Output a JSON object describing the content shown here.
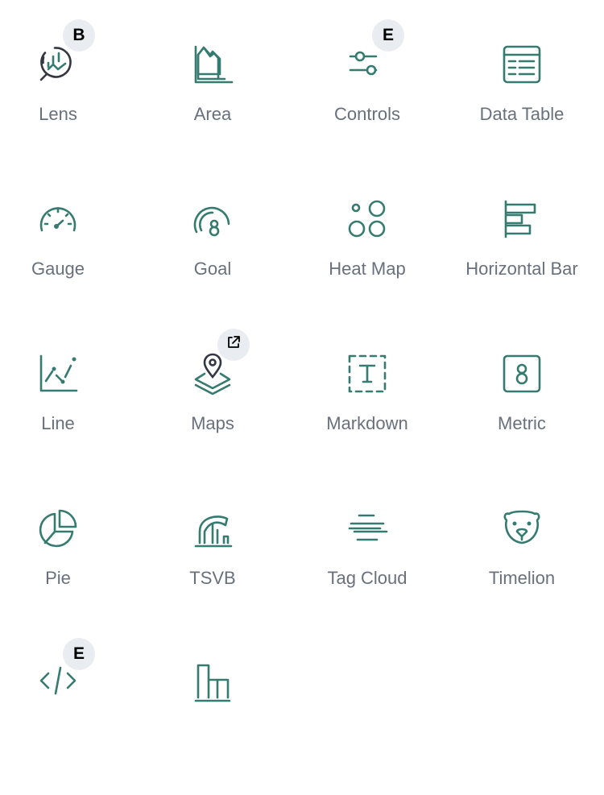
{
  "accent_color": "#357b70",
  "label_color": "#69707d",
  "items": [
    {
      "label": "Lens",
      "icon": "lens-icon",
      "badge": "B"
    },
    {
      "label": "Area",
      "icon": "area-chart-icon"
    },
    {
      "label": "Controls",
      "icon": "controls-icon",
      "badge": "E"
    },
    {
      "label": "Data Table",
      "icon": "data-table-icon"
    },
    {
      "label": "Gauge",
      "icon": "gauge-icon"
    },
    {
      "label": "Goal",
      "icon": "goal-icon"
    },
    {
      "label": "Heat Map",
      "icon": "heat-map-icon"
    },
    {
      "label": "Horizontal Bar",
      "icon": "horizontal-bar-icon"
    },
    {
      "label": "Line",
      "icon": "line-chart-icon"
    },
    {
      "label": "Maps",
      "icon": "maps-icon",
      "badge_icon": "external-link-icon"
    },
    {
      "label": "Markdown",
      "icon": "markdown-icon"
    },
    {
      "label": "Metric",
      "icon": "metric-icon"
    },
    {
      "label": "Pie",
      "icon": "pie-chart-icon"
    },
    {
      "label": "TSVB",
      "icon": "tsvb-icon"
    },
    {
      "label": "Tag Cloud",
      "icon": "tag-cloud-icon"
    },
    {
      "label": "Timelion",
      "icon": "timelion-icon"
    },
    {
      "label": "",
      "icon": "vega-code-icon",
      "badge": "E"
    },
    {
      "label": "",
      "icon": "vertical-bar-icon"
    }
  ]
}
